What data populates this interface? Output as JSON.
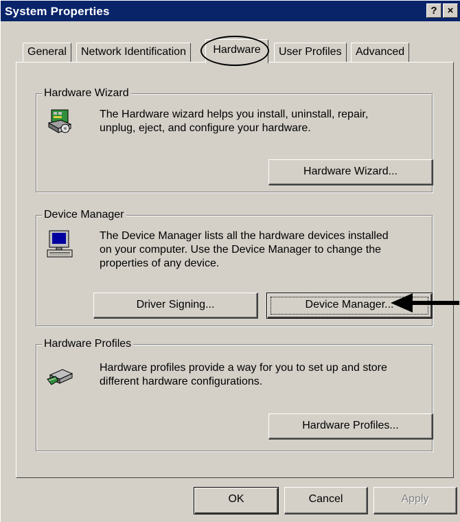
{
  "window": {
    "title": "System Properties",
    "help_label": "?",
    "close_label": "×"
  },
  "tabs": [
    {
      "label": "General"
    },
    {
      "label": "Network Identification"
    },
    {
      "label": "Hardware",
      "active": true
    },
    {
      "label": "User Profiles"
    },
    {
      "label": "Advanced"
    }
  ],
  "hardware_wizard": {
    "group_label": "Hardware Wizard",
    "description_line1": "The Hardware wizard helps you install, uninstall, repair,",
    "description_line2": "unplug, eject, and configure your hardware.",
    "button_label": "Hardware Wizard...",
    "icon": "hardware-wizard-icon"
  },
  "device_manager": {
    "group_label": "Device Manager",
    "description_line1": "The Device Manager lists all the hardware devices installed",
    "description_line2": "on your computer. Use the Device Manager to change the",
    "description_line3": "properties of any device.",
    "driver_signing_label": "Driver Signing...",
    "button_label": "Device Manager...",
    "icon": "computer-icon"
  },
  "hardware_profiles": {
    "group_label": "Hardware Profiles",
    "description_line1": "Hardware profiles provide a way for you to set up and store",
    "description_line2": "different hardware configurations.",
    "button_label": "Hardware Profiles...",
    "icon": "hardware-profiles-icon"
  },
  "footer": {
    "ok_label": "OK",
    "cancel_label": "Cancel",
    "apply_label": "Apply"
  },
  "colors": {
    "titlebar": "#0a246a",
    "face": "#d4d0c8"
  }
}
